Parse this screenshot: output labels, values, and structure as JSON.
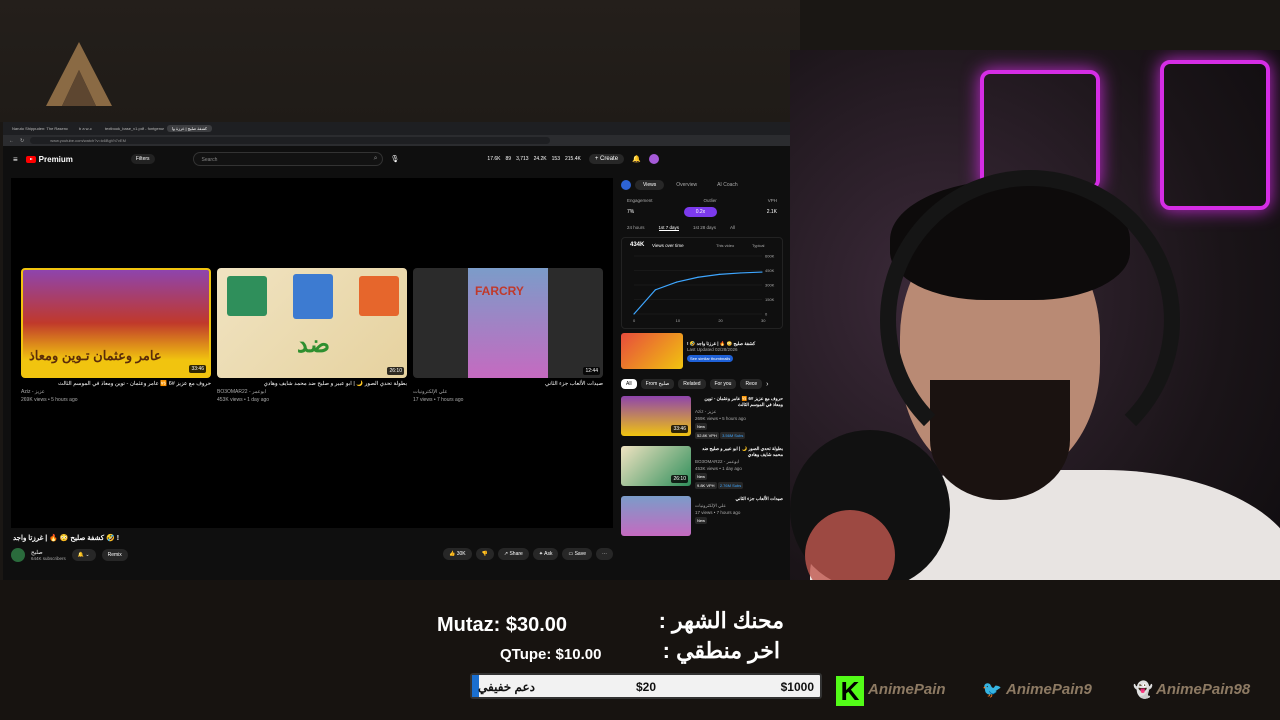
{
  "browser": {
    "tabs": [
      {
        "label": "Naruto Shippuden: The Rasenc"
      },
      {
        "label": "b a w-c"
      },
      {
        "label": "textbook_base_v1.pdf - fontgenus"
      },
      {
        "label": "كشفة صليح | غرزة وا"
      }
    ],
    "url": "www.youtube.com/watch?v=ic6BgVh7vEM"
  },
  "youtube": {
    "logo": "Premium",
    "filters": "Filters",
    "search_placeholder": "Search",
    "stats": [
      "17.6K",
      "89",
      "3,713",
      "24.2K",
      "153",
      "215.4K"
    ],
    "create": "Create"
  },
  "player": {
    "cards": [
      {
        "title": "حروف مع عزيز #6 🆚 عامر وعثمان - توين ومعاذ في الموسم الثالث",
        "channel": "Aziz - عزيز",
        "meta": "269K views • 5 hours ago",
        "duration": "33:46",
        "thumb_text": "عامر وعثمان تـوين ومعاذ"
      },
      {
        "title": "بطولة تحدي الصور 🌙 | ابو عبير و صليح ضد محمد شايف وهادي",
        "channel": "BO3OMAR22 - ابوعمر",
        "meta": "453K views • 1 day ago",
        "duration": "26:10",
        "thumb_text": "ضد"
      },
      {
        "title": "صيدات الألعاب جزء الثاني",
        "channel": "علي الإلكترونيات",
        "meta": "17 views • 7 hours ago",
        "duration": "12:44",
        "thumb_text": "FARCRY"
      }
    ]
  },
  "video": {
    "title": "كشفة صليح 😳 🔥 | غرزتا واجد 🤣 !",
    "channel": "صليح",
    "subscribers": "644K subscribers",
    "remix": "Remix",
    "likes": "30K",
    "share": "Share",
    "ask": "Ask",
    "save": "Save"
  },
  "sidebar": {
    "tabs": [
      "Views",
      "Overview",
      "AI Coach"
    ],
    "metric_labels": [
      "Engagement",
      "Outlier",
      "VPH"
    ],
    "metric_values": [
      "7%",
      "0.2x",
      "2.1K"
    ],
    "ranges": [
      "24 hours",
      "1st 7 days",
      "1st 28 days",
      "All"
    ],
    "views_total": "434K",
    "views_label": "Views over time",
    "legend_this": "This video",
    "legend_typical": "Typical",
    "strip_title": "كشفة صليح 😳 🔥 | غرزتا واجد 🤣 !",
    "strip_sub": "Last Updated 02/28/2026",
    "see_similar": "See similar thumbnails",
    "chips": [
      "All",
      "From صليح",
      "Related",
      "For you",
      "Rece"
    ],
    "recs": [
      {
        "title": "حروف مع عزيز #6 🆚 عامر وعثمان - توين ومعاذ في الموسم الثالث",
        "channel": "Aziz - عزيز",
        "meta": "269K views • 5 hours ago",
        "badge": "New",
        "extra": "52.8K VPH",
        "subs": "3.56M Subs",
        "duration": "33:46"
      },
      {
        "title": "بطولة تحدي الصور 🌙 | ابو عبير و صليح ضد محمد شايف وهادي",
        "channel": "BO3OMAR22 - ابوعمر",
        "meta": "453K views • 1 day ago",
        "badge": "New",
        "extra": "9.8K VPH",
        "subs": "2.76M Subs",
        "duration": "26:10"
      },
      {
        "title": "صيدات الألعاب جزء الثاني",
        "channel": "علي الإلكترونيات",
        "meta": "17 views • 7 hours ago",
        "badge": "New",
        "extra": "",
        "subs": "",
        "duration": ""
      }
    ]
  },
  "chart_data": {
    "type": "line",
    "x": [
      0,
      5,
      10,
      15,
      20,
      25,
      30
    ],
    "series": [
      {
        "name": "This video",
        "values": [
          0,
          250000,
          330000,
          380000,
          410000,
          425000,
          434000
        ]
      }
    ],
    "xlim": [
      0,
      30
    ],
    "ylim": [
      0,
      600000
    ],
    "yticks": [
      "600K",
      "450K",
      "300K",
      "150K",
      "0"
    ],
    "xticks": [
      "0",
      "10",
      "20",
      "30"
    ]
  },
  "overlay": {
    "donor1": "Mutaz: $30.00",
    "donor2": "QTupe: $10.00",
    "title1": "محنك الشهر :",
    "title2": "اخر منطقي :",
    "goal_label": "دعم خفيفي",
    "goal_current": "$20",
    "goal_target": "$1000",
    "goal_progress": 0.02,
    "kick_handle": "AnimePain",
    "twitter_handle": "AnimePain9",
    "snap_handle": "AnimePain98"
  },
  "colors": {
    "accent": "#7c3aed",
    "youtube_red": "#ff0000",
    "kick": "#53fc18",
    "neon": "#d52de5"
  }
}
